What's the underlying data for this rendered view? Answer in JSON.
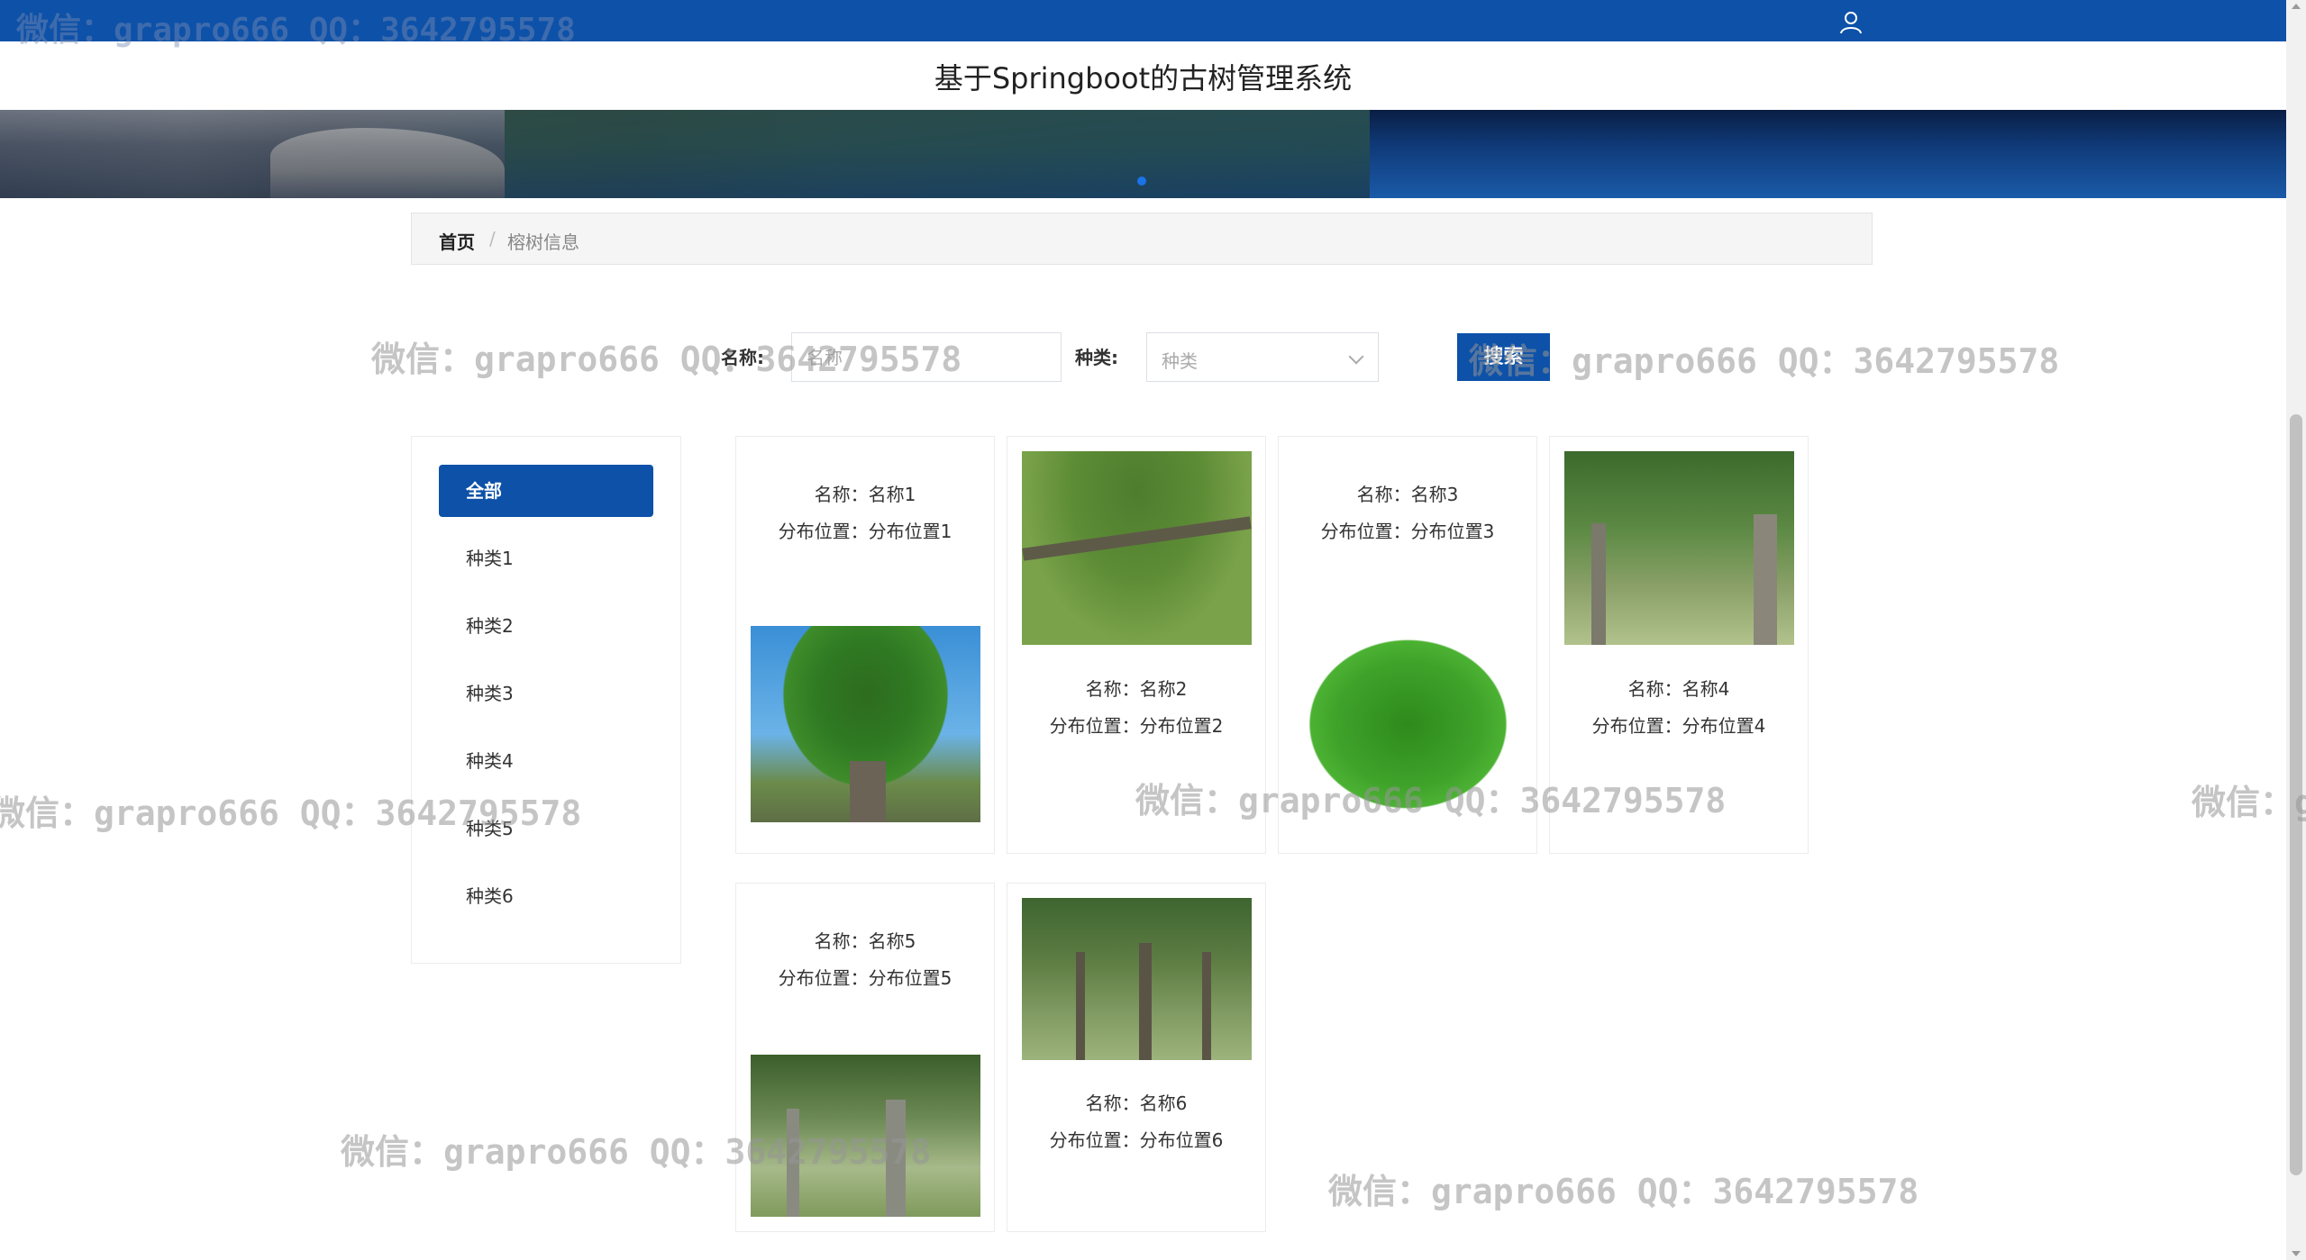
{
  "app": {
    "title": "基于Springboot的古树管理系统"
  },
  "topbar": {
    "user_icon": "user-icon"
  },
  "breadcrumb": {
    "home": "首页",
    "separator": "/",
    "current": "榕树信息"
  },
  "search": {
    "name_label": "名称:",
    "name_placeholder": "名称",
    "type_label": "种类:",
    "type_placeholder": "种类",
    "button_label": "搜索"
  },
  "sidebar": {
    "items": [
      {
        "label": "全部"
      },
      {
        "label": "种类1"
      },
      {
        "label": "种类2"
      },
      {
        "label": "种类3"
      },
      {
        "label": "种类4"
      },
      {
        "label": "种类5"
      },
      {
        "label": "种类6"
      }
    ]
  },
  "cards": [
    {
      "name": "名称：名称1",
      "loc": "分布位置：分布位置1"
    },
    {
      "name": "名称：名称2",
      "loc": "分布位置：分布位置2"
    },
    {
      "name": "名称：名称3",
      "loc": "分布位置：分布位置3"
    },
    {
      "name": "名称：名称4",
      "loc": "分布位置：分布位置4"
    },
    {
      "name": "名称：名称5",
      "loc": "分布位置：分布位置5"
    },
    {
      "name": "名称：名称6",
      "loc": "分布位置：分布位置6"
    }
  ],
  "watermark": "微信：grapro666 QQ：3642795578",
  "colors": {
    "primary": "#0d51a8"
  }
}
